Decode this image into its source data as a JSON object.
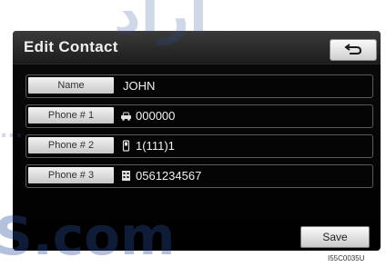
{
  "screen": {
    "title": "Edit Contact",
    "back_icon": "return-arrow-icon"
  },
  "contact_fields": [
    {
      "label": "Name",
      "value": "JOHN",
      "icon": null
    },
    {
      "label": "Phone # 1",
      "value": "000000",
      "icon": "car-phone-icon"
    },
    {
      "label": "Phone # 2",
      "value": "1(111)1",
      "icon": "mobile-phone-icon"
    },
    {
      "label": "Phone # 3",
      "value": "0561234567",
      "icon": "office-phone-icon"
    }
  ],
  "actions": {
    "save_label": "Save"
  },
  "image_code": "I55C0035U",
  "watermark": {
    "top_text": "اراد",
    "left_text": "...",
    "bottom_text": "S.com"
  }
}
